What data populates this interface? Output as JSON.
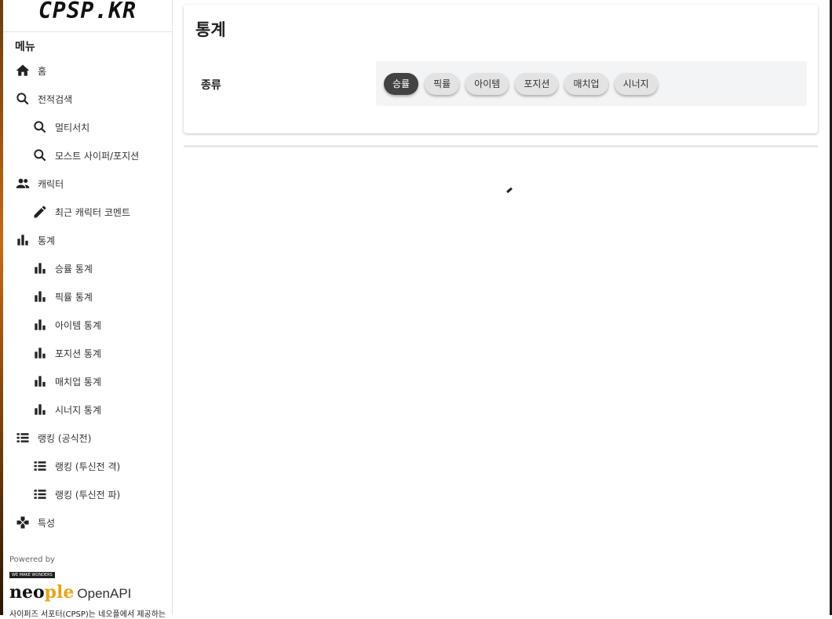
{
  "sidebar": {
    "brand": "CPSP.KR",
    "menu_title": "메뉴",
    "items": [
      {
        "label": "홈",
        "icon": "home-icon"
      },
      {
        "label": "전적검색",
        "icon": "search-icon"
      },
      {
        "label": "멀티서치",
        "icon": "search-icon"
      },
      {
        "label": "모스트 사이퍼/포지션",
        "icon": "search-icon"
      },
      {
        "label": "캐릭터",
        "icon": "people-icon"
      },
      {
        "label": "최근 캐릭터 코멘트",
        "icon": "pencil-icon"
      },
      {
        "label": "통계",
        "icon": "bar-chart-icon"
      },
      {
        "label": "승률 통계",
        "icon": "bar-chart-icon"
      },
      {
        "label": "픽률 통계",
        "icon": "bar-chart-icon"
      },
      {
        "label": "아이템 통계",
        "icon": "bar-chart-icon"
      },
      {
        "label": "포지션 통계",
        "icon": "bar-chart-icon"
      },
      {
        "label": "매치업 통계",
        "icon": "bar-chart-icon"
      },
      {
        "label": "시너지 통계",
        "icon": "bar-chart-icon"
      },
      {
        "label": "랭킹 (공식전)",
        "icon": "list-icon"
      },
      {
        "label": "랭킹 (투신전 격)",
        "icon": "list-icon"
      },
      {
        "label": "랭킹 (투신전 파)",
        "icon": "list-icon"
      },
      {
        "label": "특성",
        "icon": "gamepad-icon"
      }
    ],
    "footer": {
      "powered_by": "Powered by",
      "tagline": "WE MAKE WONDERS",
      "logo_neo": "neo",
      "logo_ple": "ple",
      "logo_openapi": "OpenAPI",
      "description": "사이퍼즈 서포터(CPSP)는 네오플에서 제공하는"
    }
  },
  "main": {
    "title": "통계",
    "filter_label": "종류",
    "chips": [
      "승률",
      "픽률",
      "아이템",
      "포지션",
      "매치업",
      "시너지"
    ],
    "selected_chip": "승률"
  },
  "colors": {
    "chip_active": "#424242",
    "chip_inactive": "#e3e3e3",
    "chip_box_bg": "#f3f4f6"
  }
}
